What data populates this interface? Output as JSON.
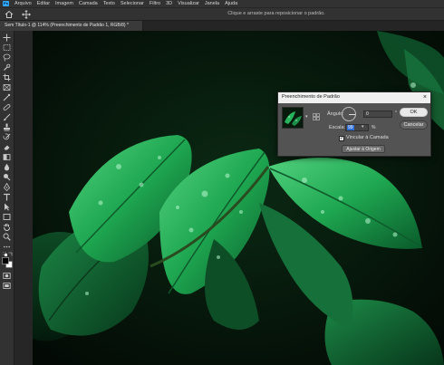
{
  "app": {
    "logo": "Ps",
    "menu": [
      "Arquivo",
      "Editar",
      "Imagem",
      "Camada",
      "Texto",
      "Selecionar",
      "Filtro",
      "3D",
      "Visualizar",
      "Janela",
      "Ajuda"
    ]
  },
  "options_bar": {
    "hint": "Clique e arraste para reposicionar o padrão."
  },
  "document": {
    "tab_title": "Sem Título-1 @ 114% (Preenchimento de Padrão 1, RGB/8) *"
  },
  "dialog": {
    "title": "Preenchimento de Padrão",
    "close": "×",
    "angle_label": "Ângulo:",
    "angle_value": "0",
    "angle_unit": "°",
    "scale_label": "Escala:",
    "scale_value": "99",
    "scale_unit": "%",
    "link_checked": true,
    "link_label": "Vincular à Camada",
    "snap_label": "Ajustar à Origem",
    "ok_label": "OK",
    "cancel_label": "Cancelar"
  },
  "tools": [
    "move-icon",
    "marquee-icon",
    "lasso-icon",
    "quick-select-icon",
    "crop-icon",
    "frame-icon",
    "eyedropper-icon",
    "healing-icon",
    "brush-icon",
    "stamp-icon",
    "history-brush-icon",
    "eraser-icon",
    "gradient-icon",
    "blur-icon",
    "dodge-icon",
    "pen-icon",
    "type-icon",
    "path-select-icon",
    "rectangle-icon",
    "hand-icon",
    "zoom-icon",
    "more-tools-icon",
    "default-colors-icon",
    "swap-colors-icon",
    "foreground-color-swatch",
    "quick-mask-icon",
    "screen-mode-icon"
  ],
  "colors": {
    "foreground": "#000000",
    "background": "#ffffff",
    "accent": "#31a8ff"
  }
}
